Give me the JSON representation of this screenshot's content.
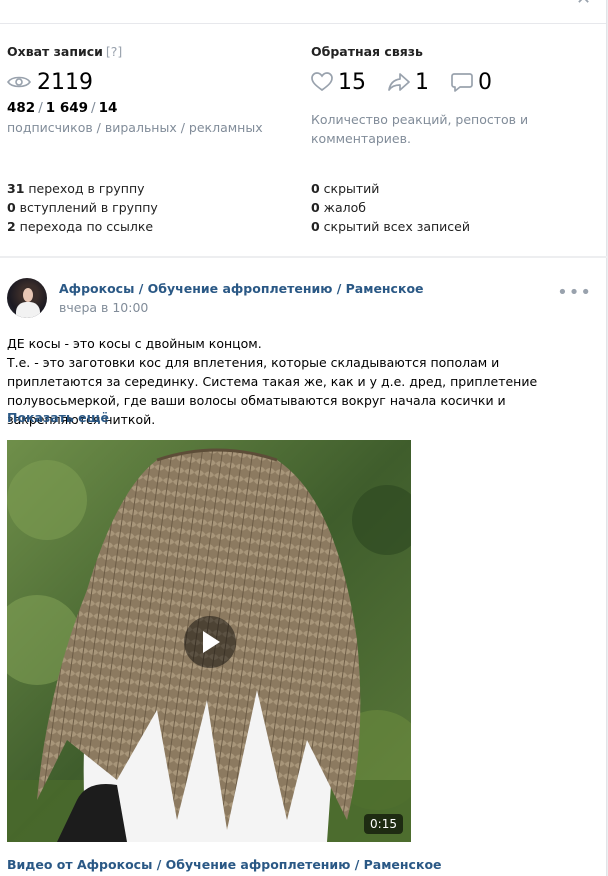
{
  "stats": {
    "reach": {
      "title": "Охват записи",
      "help": "[?]",
      "total": "2119",
      "subscribers": "482",
      "sep1": "/",
      "viral": "1 649",
      "sep2": "/",
      "ads": "14",
      "breakdown_caption": "подписчиков / виральных / рекламных"
    },
    "feedback": {
      "title": "Обратная связь",
      "reactions": "15",
      "reposts": "1",
      "comments": "0",
      "caption": "Количество реакций, репостов и комментариев."
    },
    "left_details": [
      {
        "num": "31",
        "text": " переход в группу"
      },
      {
        "num": "0",
        "text": " вступлений в группу"
      },
      {
        "num": "2",
        "text": " перехода по ссылке"
      }
    ],
    "right_details": [
      {
        "num": "0",
        "text": " скрытий"
      },
      {
        "num": "0",
        "text": " жалоб"
      },
      {
        "num": "0",
        "text": " скрытий всех записей"
      }
    ]
  },
  "post": {
    "author": "Афрокосы / Обучение афроплетению / Раменское",
    "time": "вчера в 10:00",
    "more_icon": "more-horizontal-icon",
    "text_line1": "ДЕ косы - это косы с двойным концом.",
    "text_line2": "Т.е. - это заготовки кос для вплетения, которые складываются пополам и приплетаются за серединку. Система такая же, как и у д.е. дред, приплетение полувосьмеркой, где ваши волосы обматываются вокруг начала косички и закрепляются ниткой.",
    "show_more": "Показать ещё",
    "video": {
      "duration": "0:15",
      "play_icon": "play-icon"
    },
    "video_source": "Видео от Афрокосы / Обучение афроплетению / Раменское"
  },
  "colors": {
    "link": "#2a5885",
    "muted": "#818c99",
    "background": "#edeef0"
  }
}
